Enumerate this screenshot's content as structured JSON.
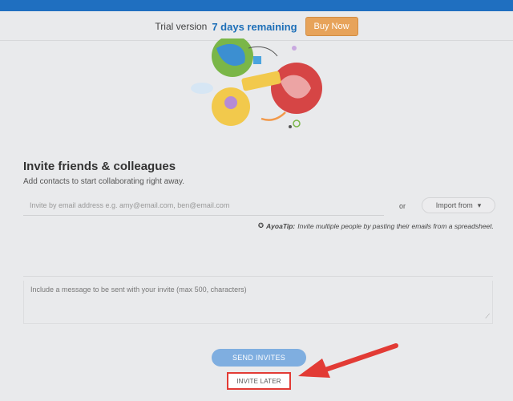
{
  "trial": {
    "prefix": "Trial version",
    "remaining": "7 days remaining",
    "buy_label": "Buy Now"
  },
  "invite": {
    "title": "Invite friends & colleagues",
    "subtitle": "Add contacts to start collaborating right away.",
    "email_placeholder": "Invite by email address e.g. amy@email.com, ben@email.com",
    "or_label": "or",
    "import_label": "Import from",
    "tip_label": "AyoaTip:",
    "tip_text": "Invite multiple people by pasting their emails from a spreadsheet.",
    "message_placeholder": "Include a message to be sent with your invite (max 500, characters)",
    "send_label": "SEND INVITES",
    "later_label": "INVITE LATER"
  },
  "colors": {
    "topbar": "#1f6fc0",
    "accent_text": "#1d6fb8",
    "buy_button": "#e7a35a",
    "send_button": "#7faee0",
    "highlight_red": "#e23b35"
  },
  "icons": {
    "tip": "lightbulb-icon",
    "import_dropdown": "caret-down-icon",
    "arrow": "red-arrow-icon"
  }
}
